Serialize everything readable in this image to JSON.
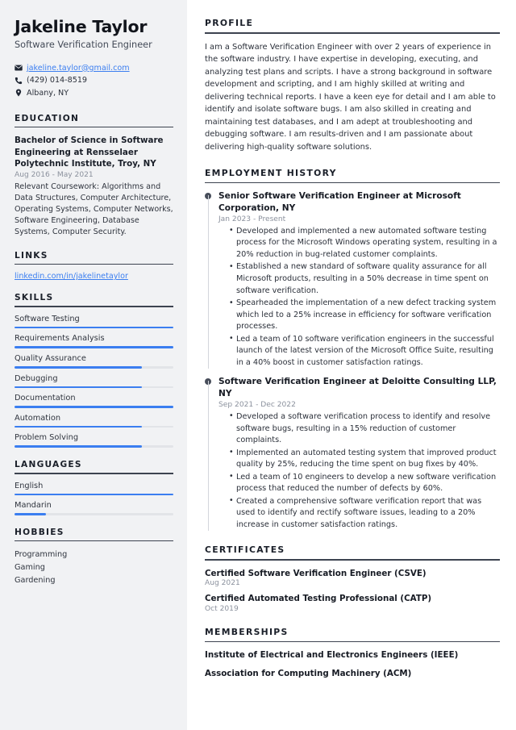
{
  "colors": {
    "sidebar_bg": "#f1f2f4",
    "accent_blue": "#3b7ef0",
    "heading_dark": "#1a1f29",
    "muted_gray": "#8b919d",
    "bar_track": "#e2e4e8"
  },
  "header": {
    "name": "Jakeline Taylor",
    "job_title": "Software Verification Engineer",
    "contacts": [
      {
        "icon": "envelope-icon",
        "text": "jakeline.taylor@gmail.com",
        "is_link": true
      },
      {
        "icon": "phone-icon",
        "text": "(429) 014-8519",
        "is_link": false
      },
      {
        "icon": "map-pin-icon",
        "text": "Albany, NY",
        "is_link": false
      }
    ]
  },
  "sidebar": {
    "education": {
      "heading": "EDUCATION",
      "degree": "Bachelor of Science in Software Engineering at Rensselaer Polytechnic Institute, Troy, NY",
      "date": "Aug 2016 - May 2021",
      "description": "Relevant Coursework: Algorithms and Data Structures, Computer Architecture, Operating Systems, Computer Networks, Software Engineering, Database Systems, Computer Security."
    },
    "links": {
      "heading": "LINKS",
      "items": [
        {
          "label": "linkedin.com/in/jakelinetaylor"
        }
      ]
    },
    "skills": {
      "heading": "SKILLS",
      "items": [
        {
          "label": "Software Testing",
          "level": 100
        },
        {
          "label": "Requirements Analysis",
          "level": 100
        },
        {
          "label": "Quality Assurance",
          "level": 80
        },
        {
          "label": "Debugging",
          "level": 80
        },
        {
          "label": "Documentation",
          "level": 100
        },
        {
          "label": "Automation",
          "level": 80
        },
        {
          "label": "Problem Solving",
          "level": 80
        }
      ]
    },
    "languages": {
      "heading": "LANGUAGES",
      "items": [
        {
          "label": "English",
          "level": 100
        },
        {
          "label": "Mandarin",
          "level": 20
        }
      ]
    },
    "hobbies": {
      "heading": "HOBBIES",
      "items": [
        {
          "label": "Programming"
        },
        {
          "label": "Gaming"
        },
        {
          "label": "Gardening"
        }
      ]
    }
  },
  "main": {
    "profile": {
      "heading": "PROFILE",
      "text": "I am a Software Verification Engineer with over 2 years of experience in the software industry. I have expertise in developing, executing, and analyzing test plans and scripts. I have a strong background in software development and scripting, and I am highly skilled at writing and delivering technical reports. I have a keen eye for detail and I am able to identify and isolate software bugs. I am also skilled in creating and maintaining test databases, and I am adept at troubleshooting and debugging software. I am results-driven and I am passionate about delivering high-quality software solutions."
    },
    "employment": {
      "heading": "EMPLOYMENT HISTORY",
      "jobs": [
        {
          "title": "Senior Software Verification Engineer at Microsoft Corporation, NY",
          "date": "Jan 2023 - Present",
          "bullets": [
            "Developed and implemented a new automated software testing process for the Microsoft Windows operating system, resulting in a 20% reduction in bug-related customer complaints.",
            "Established a new standard of software quality assurance for all Microsoft products, resulting in a 50% decrease in time spent on software verification.",
            "Spearheaded the implementation of a new defect tracking system which led to a 25% increase in efficiency for software verification processes.",
            "Led a team of 10 software verification engineers in the successful launch of the latest version of the Microsoft Office Suite, resulting in a 40% boost in customer satisfaction ratings."
          ]
        },
        {
          "title": "Software Verification Engineer at Deloitte Consulting LLP, NY",
          "date": "Sep 2021 - Dec 2022",
          "bullets": [
            "Developed a software verification process to identify and resolve software bugs, resulting in a 15% reduction of customer complaints.",
            "Implemented an automated testing system that improved product quality by 25%, reducing the time spent on bug fixes by 40%.",
            "Led a team of 10 engineers to develop a new software verification process that reduced the number of defects by 60%.",
            "Created a comprehensive software verification report that was used to identify and rectify software issues, leading to a 20% increase in customer satisfaction ratings."
          ]
        }
      ]
    },
    "certificates": {
      "heading": "CERTIFICATES",
      "items": [
        {
          "name": "Certified Software Verification Engineer (CSVE)",
          "date": "Aug 2021"
        },
        {
          "name": "Certified Automated Testing Professional (CATP)",
          "date": "Oct 2019"
        }
      ]
    },
    "memberships": {
      "heading": "MEMBERSHIPS",
      "items": [
        {
          "name": "Institute of Electrical and Electronics Engineers (IEEE)"
        },
        {
          "name": "Association for Computing Machinery (ACM)"
        }
      ]
    }
  }
}
